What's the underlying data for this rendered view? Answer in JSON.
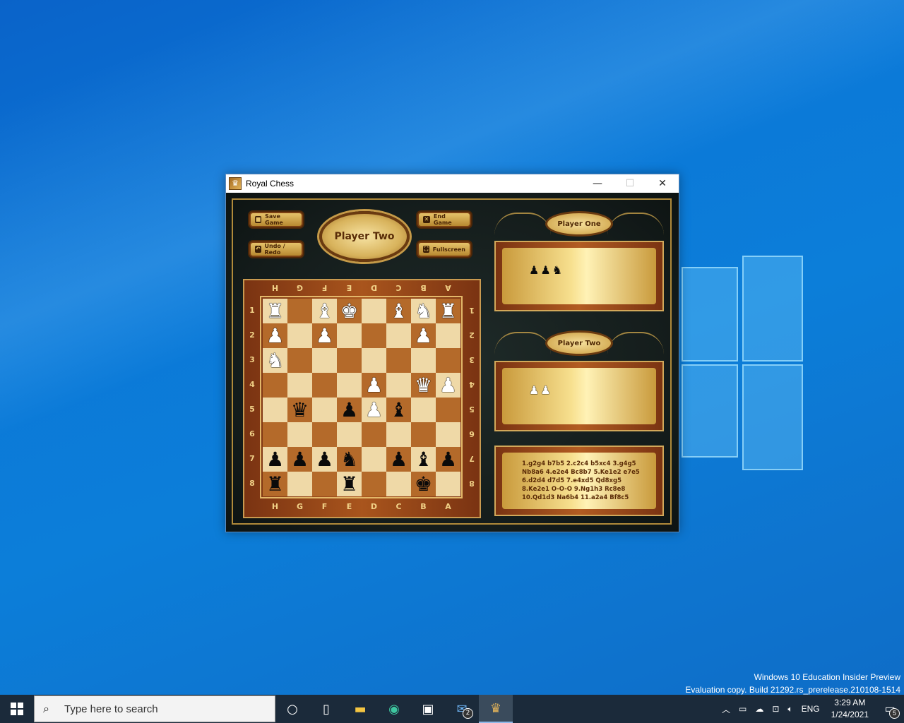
{
  "window": {
    "title": "Royal Chess",
    "controls": {
      "minimize": "—",
      "maximize": "☐",
      "close": "✕"
    }
  },
  "toolbar": {
    "save_game": "Save Game",
    "end_game": "End Game",
    "undo_redo": "Undo / Redo",
    "fullscreen": "Fullscreen",
    "save_icon": "■",
    "end_icon": "✕",
    "undo_icon": "↶",
    "fullscreen_icon": "⛶"
  },
  "turn_indicator": "Player Two",
  "board": {
    "top_files": [
      "H",
      "G",
      "F",
      "E",
      "D",
      "C",
      "B",
      "A"
    ],
    "bottom_files": [
      "H",
      "G",
      "F",
      "E",
      "D",
      "C",
      "B",
      "A"
    ],
    "ranks": [
      "1",
      "2",
      "3",
      "4",
      "5",
      "6",
      "7",
      "8"
    ],
    "squares": [
      [
        "♜w",
        "",
        "♝w",
        "♚w",
        "",
        "♝w",
        "♞w",
        "♜w"
      ],
      [
        "♟w",
        "",
        "♟w",
        "",
        "",
        "",
        "♟w",
        ""
      ],
      [
        "♞w",
        "",
        "",
        "",
        "",
        "",
        "",
        ""
      ],
      [
        "",
        "",
        "",
        "",
        "♟w",
        "",
        "♛w",
        "♟w"
      ],
      [
        "",
        "♛b",
        "",
        "♟b",
        "♟w",
        "♝b",
        "",
        ""
      ],
      [
        "",
        "",
        "",
        "",
        "",
        "",
        "",
        ""
      ],
      [
        "♟b",
        "♟b",
        "♟b",
        "♞b",
        "",
        "♟b",
        "♝b",
        "♟b"
      ],
      [
        "♜b",
        "",
        "",
        "♜b",
        "",
        "",
        "♚b",
        ""
      ]
    ]
  },
  "player_one": {
    "label": "Player One",
    "captured": "♟♟♞"
  },
  "player_two": {
    "label": "Player Two",
    "captured": "♟♟"
  },
  "move_log": [
    "1.g2g4 b7b5 2.c2c4 b5xc4 3.g4g5",
    "Nb8a6 4.e2e4 Bc8b7 5.Ke1e2 e7e5",
    "6.d2d4 d7d5 7.e4xd5 Qd8xg5",
    "8.Ke2e1 O-O-O 9.Ng1h3 Rc8e8",
    "10.Qd1d3 Na6b4 11.a2a4 Bf8c5"
  ],
  "watermark": {
    "line1": "Windows 10 Education Insider Preview",
    "line2": "Evaluation copy. Build 21292.rs_prerelease.210108-1514"
  },
  "taskbar": {
    "search_placeholder": "Type here to search",
    "mail_badge": "2",
    "language": "ENG",
    "time": "3:29 AM",
    "date": "1/24/2021",
    "notifications_badge": "5"
  }
}
